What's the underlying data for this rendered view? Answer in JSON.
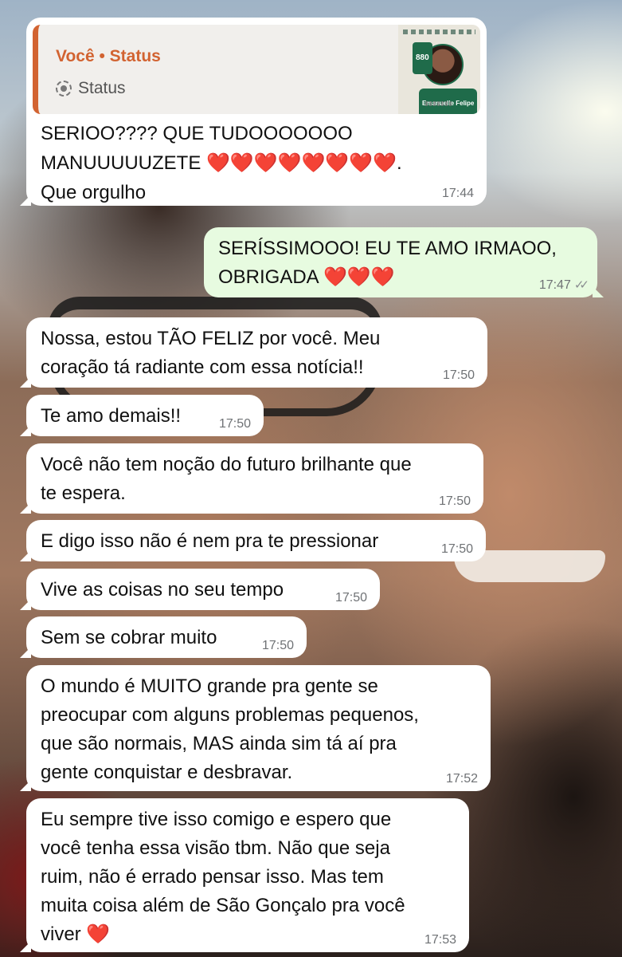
{
  "quoted": {
    "title": "Você • Status",
    "label": "Status",
    "thumbnail": {
      "badge": "880",
      "name": "Emanuelle Felipe"
    }
  },
  "messages": [
    {
      "direction": "in",
      "text": "SERIOO???? QUE TUDOOOOOOO\nMANUUUUUZETE ❤️❤️❤️❤️❤️❤️❤️❤️.\nQue orgulho",
      "time": "17:44"
    },
    {
      "direction": "out",
      "text": "SERÍSSIMOOO! EU TE AMO IRMAOO,\nOBRIGADA ❤️❤️❤️",
      "time": "17:47",
      "read_receipt": "double-check-icon"
    },
    {
      "direction": "in",
      "text": "Nossa, estou TÃO FELIZ por você. Meu\ncoração tá radiante com essa notícia!!",
      "time": "17:50"
    },
    {
      "direction": "in",
      "text": "Te amo demais!!",
      "time": "17:50"
    },
    {
      "direction": "in",
      "text": "Você não tem noção do futuro brilhante que\nte espera.",
      "time": "17:50"
    },
    {
      "direction": "in",
      "text": "E digo isso não é nem pra te pressionar",
      "time": "17:50"
    },
    {
      "direction": "in",
      "text": "Vive as coisas no seu tempo",
      "time": "17:50"
    },
    {
      "direction": "in",
      "text": "Sem se cobrar muito",
      "time": "17:50"
    },
    {
      "direction": "in",
      "text": "O mundo é MUITO grande pra gente se\npreocupar com alguns problemas pequenos,\nque são normais, MAS ainda sim tá aí pra\ngente conquistar e desbravar.",
      "time": "17:52"
    },
    {
      "direction": "in",
      "text": "Eu sempre tive isso comigo e espero que\nvocê tenha essa visão tbm. Não que seja\nruim, não é errado pensar isso. Mas tem\nmuita coisa além de São Gonçalo pra você\nviver ❤️",
      "time": "17:53"
    }
  ],
  "colors": {
    "incoming_bubble": "#ffffff",
    "outgoing_bubble": "#e7fbe0",
    "quote_accent": "#d26331",
    "timestamp": "#6f7275"
  }
}
